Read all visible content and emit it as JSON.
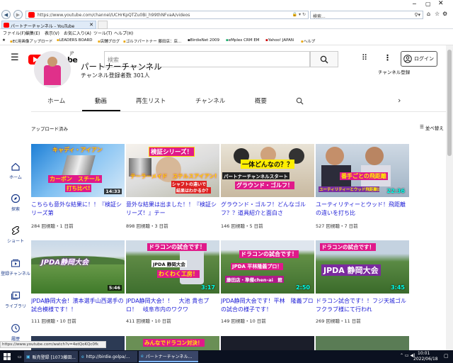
{
  "browser": {
    "url": "https://www.youtube.com/channel/UCHrKpQTZu0Bi_h99thNFvaA/videos",
    "search_placeholder": "検索...",
    "tab_title": "パートナーチャンネル - YouTube",
    "menu": [
      "ファイル(F)",
      "編集(E)",
      "表示(V)",
      "お気に入り(A)",
      "ツール(T)",
      "ヘルプ(H)"
    ],
    "favorites": [
      "EC用画像アップロード",
      "LEADERS BOARD",
      "店舗ブログ",
      "ゴルフパートナー 藤田店：店...",
      "BirdieNet 2009",
      "eMplex CRM EM",
      "Yahoo! JAPAN",
      "ヘルプ"
    ],
    "status_url": "https://www.youtube.com/watch?v=4etQoKQc0fk"
  },
  "youtube": {
    "logo_text": "YouTube",
    "region": "JP",
    "search_placeholder": "検索",
    "login_label": "ログイン",
    "subscribe_label": "チャンネル登録",
    "channel_name": "パートナーチャンネル",
    "subscriber_count": "チャンネル登録者数 301人",
    "tabs": [
      "ホーム",
      "動画",
      "再生リスト",
      "チャンネル",
      "概要"
    ],
    "active_tab": "動画",
    "section_label": "アップロード済み",
    "sort_label": "並べ替え",
    "sidebar": [
      "ホーム",
      "探索",
      "ショート",
      "登録チャンネル",
      "ライブラリ",
      "履歴"
    ]
  },
  "videos": [
    {
      "title": "こちらも意外な結果に！！『検証シリーズ第",
      "meta": "284 回視聴・1 日前",
      "duration": "14:33",
      "overlays": [
        "キャディ・アイアン",
        "カーボン　スチール",
        "打ち比べ!"
      ]
    },
    {
      "title": "意外な結果は出ました！！『検証シリーズ！』テー",
      "meta": "898 回視聴・3 日前",
      "duration": "",
      "overlays": [
        "検証シリーズ！",
        "テーラーメイド　ステルスアイアン!",
        "シャフトの違いで",
        "結果はわかるか？"
      ]
    },
    {
      "title": "グラウンド・ゴルフ！どんなゴルフ？？道具紹介と面白さ",
      "meta": "146 回視聴・5 日前",
      "duration": "",
      "overlays": [
        "一体どんなの？？",
        "パートナーチャンネルスタート",
        "グラウンド・ゴルフ！"
      ]
    },
    {
      "title": "ユーティリティーとウッド！飛距離の違いを打ち比",
      "meta": "527 回視聴・7 日前",
      "duration": "22:36",
      "overlays": [
        "番手ごとの飛距離",
        "ユーティリティーとウッド飛距離比較!"
      ]
    },
    {
      "title": "JPDA静岡大会！濱本選手山西選手の試合模様です！！",
      "meta": "111 回視聴・10 日前",
      "duration": "5:46",
      "overlays": [
        "JPDA静岡大会"
      ]
    },
    {
      "title": "JPDA静岡大会！！　大池 貴也プロ！　岐阜市内のワクワ",
      "meta": "411 回視聴・10 日前",
      "duration": "3:17",
      "overlays": [
        "ドラコンの試合です！",
        "JPDA 静岡大会",
        "わくわく工房！"
      ]
    },
    {
      "title": "JPDA静岡大会です！平林　隆義プロの試合の様子です！",
      "meta": "149 回視聴・10 日前",
      "duration": "2:50",
      "overlays": [
        "ドラコンの試合です！",
        "JPDA 平林隆義プロ！",
        "藤田店・準備chen-ai　館"
      ]
    },
    {
      "title": "ドラコン試合です！！フジ天城ゴルフクラブ様にて行われ",
      "meta": "269 回視聴・11 日前",
      "duration": "3:45",
      "overlays": [
        "ドラコンの試合です！",
        "JPDA 静岡大会"
      ]
    }
  ],
  "next_row_overlay": "みんなでドラコン対決！",
  "taskbar": {
    "items": [
      "販売登録 [1073藤田...",
      "http://birdie.golpa/...",
      "パートナーチャンネル..."
    ],
    "time": "10:01",
    "date": "2022/06/18"
  },
  "colors": {
    "youtube_red": "#ff0000",
    "link_blue": "#1b1bd6",
    "overlay_pink": "#ff3fae",
    "overlay_yellow": "#ffd400"
  }
}
